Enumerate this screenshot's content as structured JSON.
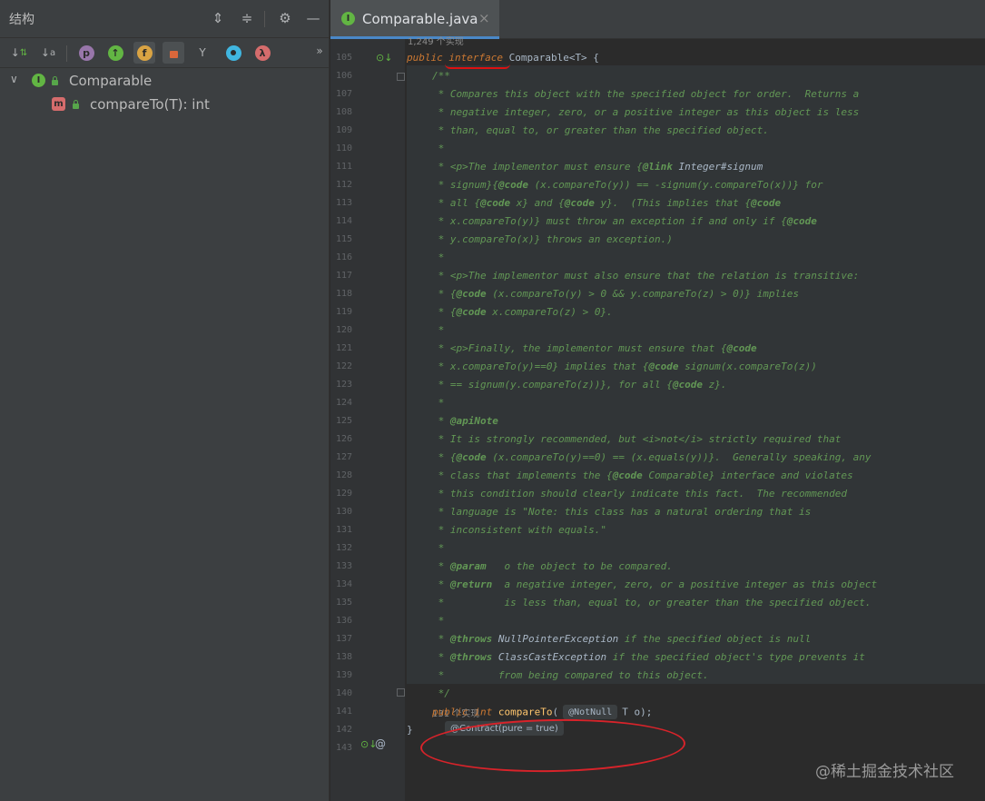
{
  "left_panel": {
    "title": "结构",
    "header_icons": [
      "expand-all-icon",
      "collapse-all-icon",
      "gear-icon",
      "minimize-icon"
    ],
    "toolbar": [
      {
        "name": "sort-by-visibility-icon",
        "glyph": "↓"
      },
      {
        "name": "sort-alpha-icon",
        "glyph": "↓a"
      },
      {
        "name": "show-properties-icon",
        "glyph": "p"
      },
      {
        "name": "show-inherited-icon",
        "glyph": "↑"
      },
      {
        "name": "show-fields-icon",
        "glyph": "f"
      },
      {
        "name": "show-non-public-icon",
        "glyph": "🔒"
      },
      {
        "name": "show-anonymous-icon",
        "glyph": "Y"
      },
      {
        "name": "show-tests-icon",
        "glyph": "●"
      },
      {
        "name": "show-lambdas-icon",
        "glyph": "λ"
      }
    ],
    "overflow": "»",
    "tree": {
      "root_label": "Comparable",
      "child_label": "compareTo(T): int"
    }
  },
  "editor": {
    "tab_label": "Comparable.java",
    "tab_close": "×",
    "hint_top": "1,249 个实现",
    "hint_bottom": "131 个实现",
    "annotation_pill": "@Contract(pure = true)",
    "param_pill": "@NotNull",
    "watermark": "@稀土掘金技术社区",
    "lines": [
      {
        "n": "105"
      },
      {
        "n": "106"
      },
      {
        "n": "107"
      },
      {
        "n": "108"
      },
      {
        "n": "109"
      },
      {
        "n": "110"
      },
      {
        "n": "111"
      },
      {
        "n": "112"
      },
      {
        "n": "113"
      },
      {
        "n": "114"
      },
      {
        "n": "115"
      },
      {
        "n": "116"
      },
      {
        "n": "117"
      },
      {
        "n": "118"
      },
      {
        "n": "119"
      },
      {
        "n": "120"
      },
      {
        "n": "121"
      },
      {
        "n": "122"
      },
      {
        "n": "123"
      },
      {
        "n": "124"
      },
      {
        "n": "125"
      },
      {
        "n": "126"
      },
      {
        "n": "127"
      },
      {
        "n": "128"
      },
      {
        "n": "129"
      },
      {
        "n": "130"
      },
      {
        "n": "131"
      },
      {
        "n": "132"
      },
      {
        "n": "133"
      },
      {
        "n": "134"
      },
      {
        "n": "135"
      },
      {
        "n": "136"
      },
      {
        "n": "137"
      },
      {
        "n": "138"
      },
      {
        "n": "139"
      },
      {
        "n": "140"
      },
      {
        "n": "141"
      },
      {
        "n": "142"
      },
      {
        "n": "143"
      }
    ],
    "code": {
      "l105": [
        "public ",
        "interface",
        " Comparable<T> {"
      ],
      "l106": "/**",
      "l107": " * Compares this object with the specified object for order.  Returns a",
      "l108": " * negative integer, zero, or a positive integer as this object is less",
      "l109": " * than, equal to, or greater than the specified object.",
      "l110": " *",
      "l111": [
        " * <p>The implementor must ensure {",
        "@link",
        " Integer#signum"
      ],
      "l112": [
        " * signum}{",
        "@code",
        " (x.compareTo(y)) == -signum(y.compareTo(x))} for"
      ],
      "l113": [
        " * all {",
        "@code",
        " x} and {",
        "@code",
        " y}.  (This implies that {",
        "@code"
      ],
      "l114": [
        " * x.compareTo(y)} must throw an exception if and only if {",
        "@code"
      ],
      "l115": " * y.compareTo(x)} throws an exception.)",
      "l116": " *",
      "l117": " * <p>The implementor must also ensure that the relation is transitive:",
      "l118": [
        " * {",
        "@code",
        " (x.compareTo(y) > 0 && y.compareTo(z) > 0)} implies"
      ],
      "l119": [
        " * {",
        "@code",
        " x.compareTo(z) > 0}."
      ],
      "l120": " *",
      "l121": [
        " * <p>Finally, the implementor must ensure that {",
        "@code"
      ],
      "l122": [
        " * x.compareTo(y)==0} implies that {",
        "@code",
        " signum(x.compareTo(z))"
      ],
      "l123": [
        " * == signum(y.compareTo(z))}, for all {",
        "@code",
        " z}."
      ],
      "l124": " *",
      "l125": [
        " * ",
        "@apiNote"
      ],
      "l126": " * It is strongly recommended, but <i>not</i> strictly required that",
      "l127": [
        " * {",
        "@code",
        " (x.compareTo(y)==0) == (x.equals(y))}.  Generally speaking, any"
      ],
      "l128": [
        " * class that implements the {",
        "@code",
        " Comparable} interface and violates"
      ],
      "l129": " * this condition should clearly indicate this fact.  The recommended",
      "l130": " * language is \"Note: this class has a natural ordering that is",
      "l131": " * inconsistent with equals.\"",
      "l132": " *",
      "l133": [
        " * ",
        "@param",
        "   o the object to be compared."
      ],
      "l134": [
        " * ",
        "@return",
        "  a negative integer, zero, or a positive integer as this object"
      ],
      "l135": " *          is less than, equal to, or greater than the specified object.",
      "l136": " *",
      "l137": [
        " * ",
        "@throws",
        " NullPointerException",
        " if the specified object is null"
      ],
      "l138": [
        " * ",
        "@throws",
        " ClassCastException",
        " if the specified object's type prevents it"
      ],
      "l139": " *         from being compared to this object.",
      "l140": " */",
      "l141": [
        "public int ",
        "compareTo",
        "(",
        "T o);"
      ],
      "l142": "}"
    }
  },
  "colors": {
    "comment": "#629755",
    "keyword": "#cc7832",
    "text": "#a9b7c6",
    "method": "#ffc66d",
    "annot_red": "#d8232a"
  }
}
